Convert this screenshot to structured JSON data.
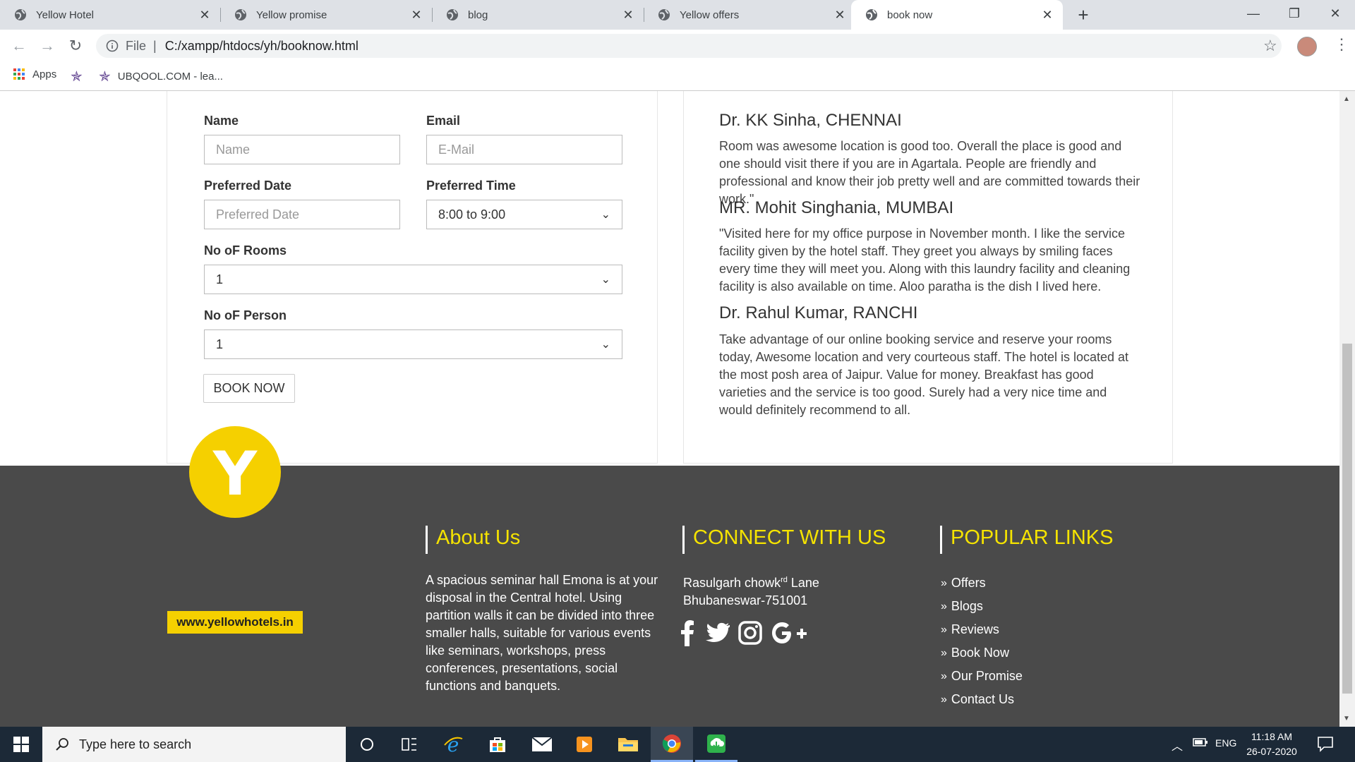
{
  "browser": {
    "tabs": [
      {
        "title": "Yellow Hotel",
        "active": false
      },
      {
        "title": "Yellow promise",
        "active": false
      },
      {
        "title": "blog",
        "active": false
      },
      {
        "title": "Yellow offers",
        "active": false
      },
      {
        "title": "book now",
        "active": true
      }
    ],
    "new_tab": "+",
    "address": {
      "scheme": "File",
      "url": "C:/xampp/htdocs/yh/booknow.html"
    },
    "bookmarks": [
      {
        "label": "Apps",
        "icon": "apps-grid-icon"
      },
      {
        "label": "",
        "icon": "star-bookmark-icon"
      },
      {
        "label": "UBQOOL.COM - lea...",
        "icon": "star-bookmark-icon"
      }
    ]
  },
  "form": {
    "name_label": "Name",
    "name_placeholder": "Name",
    "email_label": "Email",
    "email_placeholder": "E-Mail",
    "date_label": "Preferred Date",
    "date_placeholder": "Preferred Date",
    "time_label": "Preferred Time",
    "time_value": "8:00 to 9:00",
    "rooms_label": "No oF Rooms",
    "rooms_value": "1",
    "persons_label": "No oF Person",
    "persons_value": "1",
    "submit_label": "BOOK NOW"
  },
  "reviews": [
    {
      "name": "Dr. KK Sinha, CHENNAI",
      "text": "Room was awesome location is good too. Overall the place is good and one should visit there if you are in Agartala. People are friendly and professional and know their job pretty well and are committed towards their work.\""
    },
    {
      "name": "MR. Mohit Singhania, MUMBAI",
      "text": "\"Visited here for my office purpose in November month. I like the service facility given by the hotel staff. They greet you always by smiling faces every time they will meet you. Along with this laundry facility and cleaning facility is also available on time. Aloo paratha is the dish I lived here."
    },
    {
      "name": "Dr. Rahul Kumar, RANCHI",
      "text": "Take advantage of our online booking service and reserve your rooms today, Awesome location and very courteous staff. The hotel is located at the most posh area of Jaipur. Value for money. Breakfast has good varieties and the service is too good. Surely had a very nice time and would definitely recommend to all."
    }
  ],
  "footer": {
    "logo_letter": "Y",
    "logo_url": "www.yellowhotels.in",
    "about_heading": "About Us",
    "about_text": "A spacious seminar hall Emona is at your disposal in the Central hotel. Using partition walls it can be divided into three smaller halls, suitable for various events like seminars, workshops, press conferences, presentations, social functions and banquets.",
    "connect_heading": "CONNECT WITH US",
    "address_line1_pre": "Rasulgarh chowk",
    "address_line1_sup": "rd",
    "address_line1_post": " Lane",
    "address_line2": "Bhubaneswar-751001",
    "social_icons": [
      "facebook-icon",
      "twitter-icon",
      "instagram-icon",
      "google-plus-icon"
    ],
    "links_heading": "POPULAR LINKS",
    "links": [
      "Offers",
      "Blogs",
      "Reviews",
      "Book Now",
      "Our Promise",
      "Contact Us"
    ]
  },
  "taskbar": {
    "search_placeholder": "Type here to search",
    "language": "ENG",
    "time": "11:18 AM",
    "date": "26-07-2020"
  },
  "colors": {
    "accent_yellow": "#f5d000",
    "heading_yellow": "#f5e300",
    "footer_bg": "#4a4a4a",
    "taskbar_bg": "#1c2937"
  }
}
